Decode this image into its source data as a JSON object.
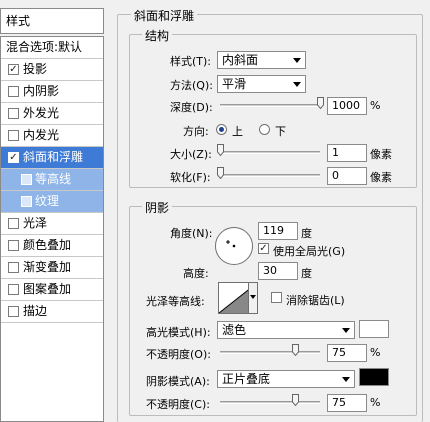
{
  "sidebar": {
    "header": "样式",
    "blend_defaults": "混合选项:默认",
    "items": [
      {
        "label": "投影",
        "checked": true
      },
      {
        "label": "内阴影",
        "checked": false
      },
      {
        "label": "外发光",
        "checked": false
      },
      {
        "label": "内发光",
        "checked": false
      },
      {
        "label": "斜面和浮雕",
        "checked": true,
        "selected": true
      },
      {
        "label": "等高线",
        "checked": false,
        "sub": true
      },
      {
        "label": "纹理",
        "checked": false,
        "sub": true
      },
      {
        "label": "光泽",
        "checked": false
      },
      {
        "label": "颜色叠加",
        "checked": false
      },
      {
        "label": "渐变叠加",
        "checked": false
      },
      {
        "label": "图案叠加",
        "checked": false
      },
      {
        "label": "描边",
        "checked": false
      }
    ]
  },
  "bevel": {
    "title": "斜面和浮雕",
    "structure": {
      "title": "结构",
      "style_label": "样式(T):",
      "style_value": "内斜面",
      "technique_label": "方法(Q):",
      "technique_value": "平滑",
      "depth_label": "深度(D):",
      "depth_value": "1000",
      "depth_unit": "%",
      "depth_fraction": 1.0,
      "direction_label": "方向:",
      "dir_up": "上",
      "dir_down": "下",
      "direction_selected": "上",
      "size_label": "大小(Z):",
      "size_value": "1",
      "size_unit": "像素",
      "size_fraction": 0.0,
      "soften_label": "软化(F):",
      "soften_value": "0",
      "soften_unit": "像素",
      "soften_fraction": 0.0
    },
    "shading": {
      "title": "阴影",
      "angle_label": "角度(N):",
      "angle_value": "119",
      "angle_unit": "度",
      "global_light_label": "使用全局光(G)",
      "global_light_checked": true,
      "altitude_label": "高度:",
      "altitude_value": "30",
      "altitude_unit": "度",
      "gloss_label": "光泽等高线:",
      "antialias_label": "消除锯齿(L)",
      "antialias_checked": false,
      "highlight_mode_label": "高光模式(H):",
      "highlight_mode_value": "滤色",
      "highlight_color": "#ffffff",
      "highlight_opacity_label": "不透明度(O):",
      "highlight_opacity_value": "75",
      "highlight_opacity_unit": "%",
      "shadow_mode_label": "阴影模式(A):",
      "shadow_mode_value": "正片叠底",
      "shadow_color": "#000000",
      "shadow_opacity_label": "不透明度(C):",
      "shadow_opacity_value": "75",
      "shadow_opacity_unit": "%"
    }
  }
}
